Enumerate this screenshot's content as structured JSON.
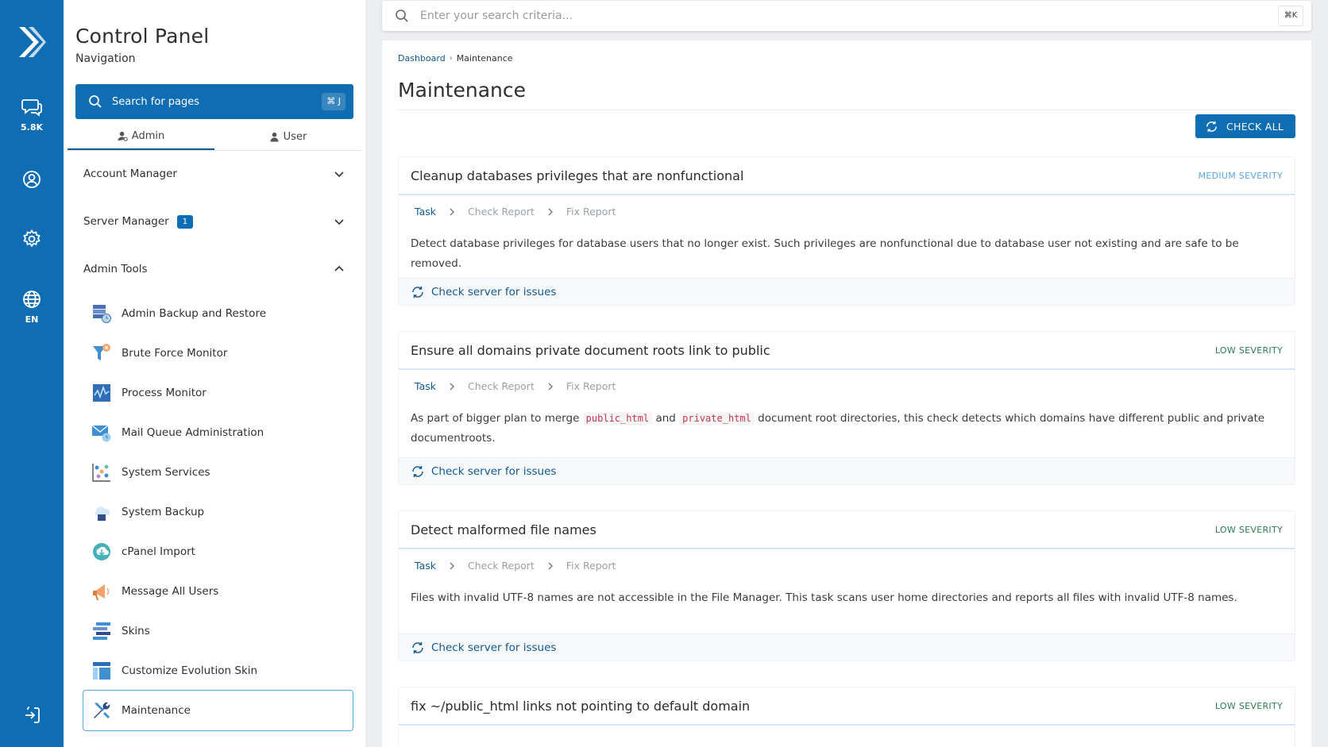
{
  "rail": {
    "messages_count": "5.8K",
    "language": "EN"
  },
  "nav": {
    "title": "Control Panel",
    "subtitle": "Navigation",
    "search_label": "Search for pages",
    "search_shortcut": "⌘ J",
    "tabs": [
      {
        "label": "Admin",
        "active": true
      },
      {
        "label": "User",
        "active": false
      }
    ],
    "groups": [
      {
        "label": "Account Manager",
        "expanded": false
      },
      {
        "label": "Server Manager",
        "badge": "1",
        "expanded": false
      },
      {
        "label": "Admin Tools",
        "expanded": true
      }
    ],
    "items": [
      {
        "label": "Admin Backup and Restore",
        "icon": "backup-restore-icon"
      },
      {
        "label": "Brute Force Monitor",
        "icon": "brute-force-icon"
      },
      {
        "label": "Process Monitor",
        "icon": "process-monitor-icon"
      },
      {
        "label": "Mail Queue Administration",
        "icon": "mail-queue-icon"
      },
      {
        "label": "System Services",
        "icon": "system-services-icon"
      },
      {
        "label": "System Backup",
        "icon": "system-backup-icon"
      },
      {
        "label": "cPanel Import",
        "icon": "cpanel-import-icon"
      },
      {
        "label": "Message All Users",
        "icon": "megaphone-icon"
      },
      {
        "label": "Skins",
        "icon": "skins-icon"
      },
      {
        "label": "Customize Evolution Skin",
        "icon": "customize-skin-icon"
      },
      {
        "label": "Maintenance",
        "icon": "tools-icon",
        "selected": true
      }
    ]
  },
  "top_search": {
    "placeholder": "Enter your search criteria...",
    "shortcut": "⌘K"
  },
  "main": {
    "breadcrumb": {
      "home": "Dashboard",
      "current": "Maintenance"
    },
    "title": "Maintenance",
    "check_all_label": "CHECK ALL",
    "steps": {
      "task": "Task",
      "check": "Check Report",
      "fix": "Fix Report"
    },
    "check_server_label": "Check server for issues",
    "tasks": [
      {
        "title": "Cleanup databases privileges that are nonfunctional",
        "severity": "MEDIUM SEVERITY",
        "description": "Detect database privileges for database users that no longer exist. Such privileges are nonfunctional due to database user not existing and are safe to be removed."
      },
      {
        "title": "Ensure all domains private document roots link to public",
        "severity": "LOW SEVERITY",
        "desc_part1": "As part of bigger plan to merge ",
        "code1": "public_html",
        "desc_part2": " and ",
        "code2": "private_html",
        "desc_part3": " document root directories, this check detects which domains have different public and private documentroots."
      },
      {
        "title": "Detect malformed file names",
        "severity": "LOW SEVERITY",
        "description": "Files with invalid UTF-8 names are not accessible in the File Manager. This task scans user home directories and reports all files with invalid UTF-8 names."
      },
      {
        "title": "fix ~/public_html links not pointing to default domain",
        "severity": "LOW SEVERITY"
      }
    ]
  },
  "colors": {
    "brand": "#0f6db3",
    "link": "#0f5a93",
    "medium_severity": "#5ba7d9",
    "low_severity": "#2a7b55",
    "code_text": "#c6364e"
  }
}
